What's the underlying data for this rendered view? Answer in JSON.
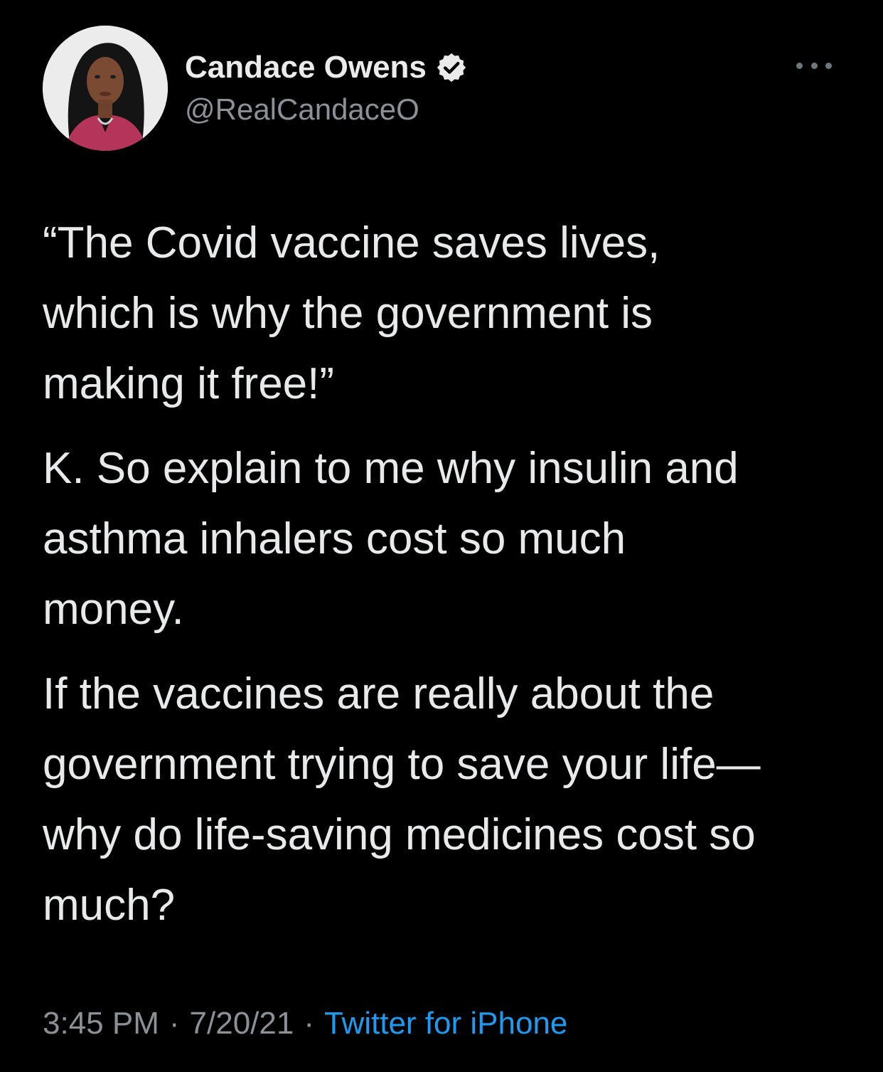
{
  "author": {
    "display_name": "Candace Owens",
    "handle": "@RealCandaceO",
    "verified": true
  },
  "icons": {
    "verified": "verified-badge-icon",
    "more": "more-options-icon"
  },
  "tweet": {
    "paragraphs": [
      "“The Covid vaccine saves lives,\nwhich is why the government is\nmaking it free!”",
      "K. So explain to me why insulin and\nasthma inhalers cost so much\nmoney.",
      "If the vaccines are really about the\ngovernment trying to save your life—\nwhy do life-saving medicines cost so\nmuch?"
    ]
  },
  "meta": {
    "time": "3:45 PM",
    "date": "7/20/21",
    "separator": "·",
    "source": "Twitter for iPhone"
  },
  "colors": {
    "background": "#000000",
    "text": "#e7e9ea",
    "secondary_text": "#8b9196",
    "link": "#1d9bf0"
  }
}
